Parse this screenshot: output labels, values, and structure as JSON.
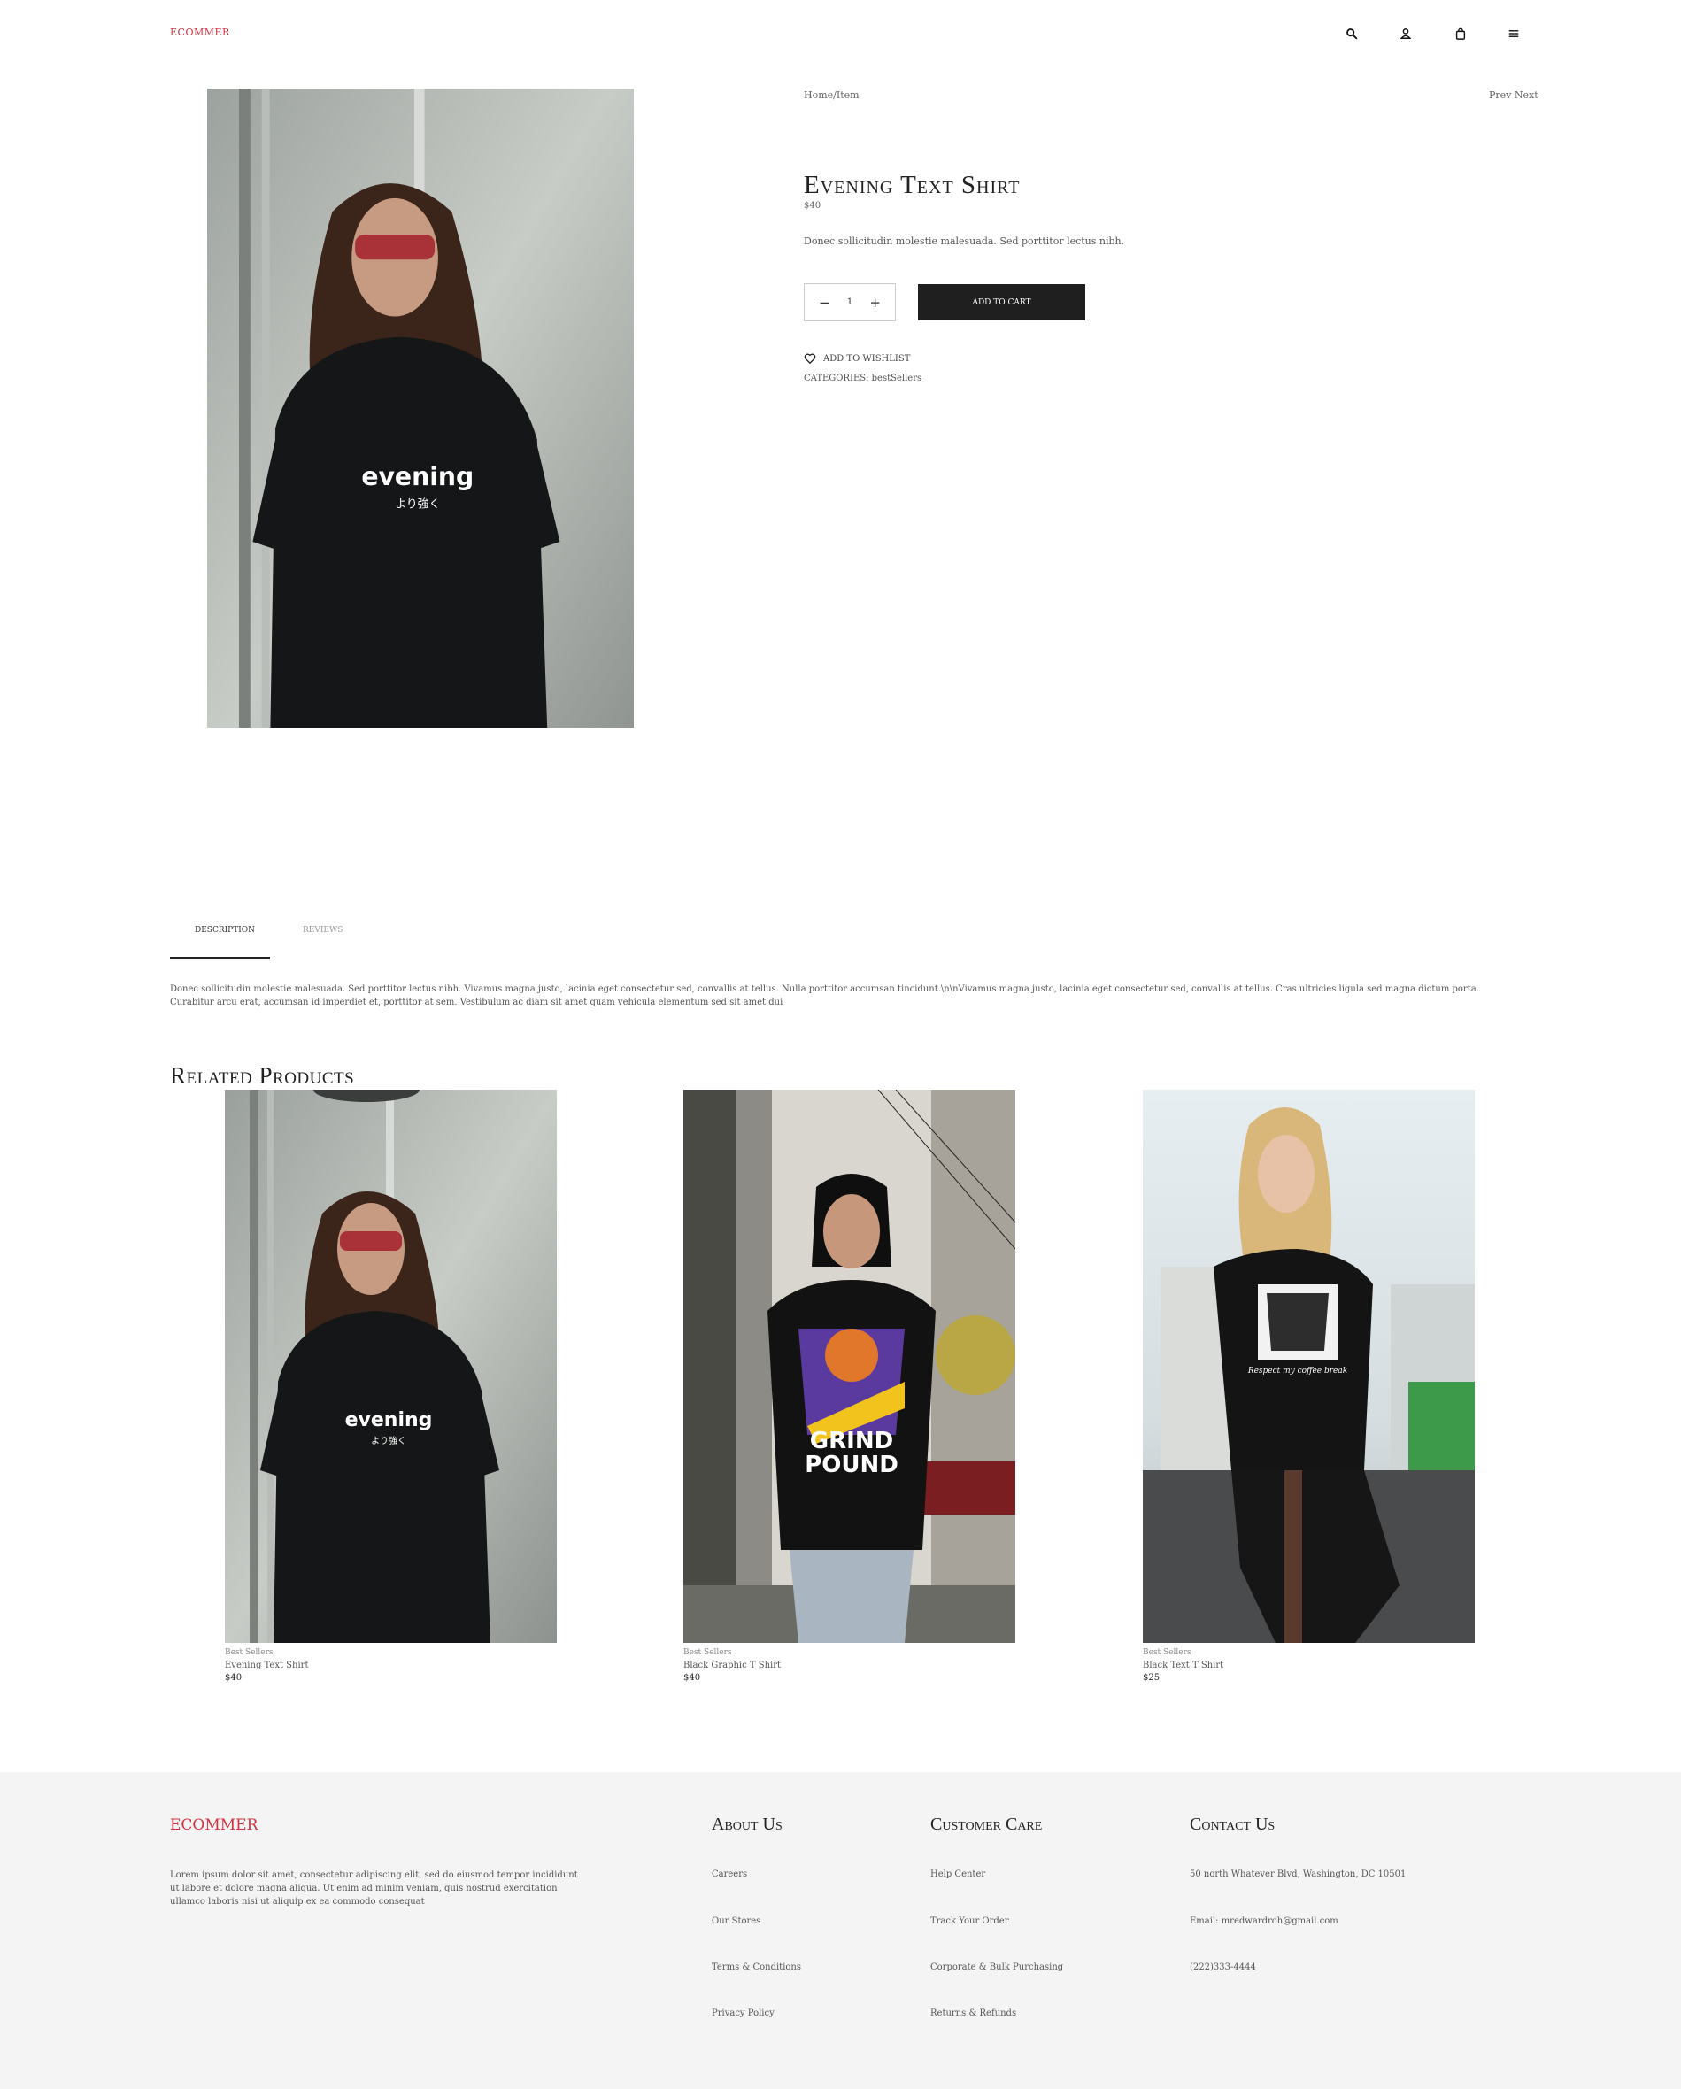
{
  "header": {
    "logo": "ECOMMER",
    "icons": [
      "search-icon",
      "user-icon",
      "bag-icon",
      "menu-icon"
    ]
  },
  "product": {
    "breadcrumb": "Home/Item",
    "prev_label": "Prev",
    "next_label": "Next",
    "title": "Evening Text Shirt",
    "price": "$40",
    "short_description": "Donec sollicitudin molestie malesuada. Sed porttitor lectus nibh.",
    "quantity": "1",
    "minus_label": "−",
    "plus_label": "+",
    "add_to_cart": "ADD TO CART",
    "wishlist": "ADD TO WISHLIST",
    "categories": "CATEGORIES: bestSellers"
  },
  "tabs": {
    "description": "DESCRIPTION",
    "reviews": "REVIEWS",
    "description_text": "Donec sollicitudin molestie malesuada. Sed porttitor lectus nibh. Vivamus magna justo, lacinia eget consectetur sed, convallis at tellus. Nulla porttitor accumsan tincidunt.\\n\\nVivamus magna justo, lacinia eget consectetur sed, convallis at tellus. Cras ultricies ligula sed magna dictum porta. Curabitur arcu erat, accumsan id imperdiet et, porttitor at sem. Vestibulum ac diam sit amet quam vehicula elementum sed sit amet dui"
  },
  "related": {
    "title": "Related Products",
    "items": [
      {
        "category": "Best Sellers",
        "name": "Evening Text Shirt",
        "price": "$40"
      },
      {
        "category": "Best Sellers",
        "name": "Black Graphic T Shirt",
        "price": "$40"
      },
      {
        "category": "Best Sellers",
        "name": "Black Text T Shirt",
        "price": "$25"
      }
    ]
  },
  "footer": {
    "logo": "ECOMMER",
    "about_text": "Lorem ipsum dolor sit amet, consectetur adipiscing elit, sed do eiusmod tempor incididunt ut labore et dolore magna aliqua. Ut enim ad minim veniam, quis nostrud exercitation ullamco laboris nisi ut aliquip ex ea commodo consequat",
    "about_us": {
      "heading": "About Us",
      "links": [
        "Careers",
        "Our Stores",
        "Terms & Conditions",
        "Privacy Policy"
      ]
    },
    "customer_care": {
      "heading": "Customer Care",
      "links": [
        "Help Center",
        "Track Your Order",
        "Corporate & Bulk Purchasing",
        "Returns & Refunds"
      ]
    },
    "contact": {
      "heading": "Contact Us",
      "address": "50 north Whatever Blvd, Washington, DC 10501",
      "email": "Email: mredwardroh@gmail.com",
      "phone": "(222)333-4444"
    }
  },
  "colors": {
    "brand": "#d0323f",
    "button": "#1f1f1f",
    "footer_bg": "#f4f4f4"
  }
}
